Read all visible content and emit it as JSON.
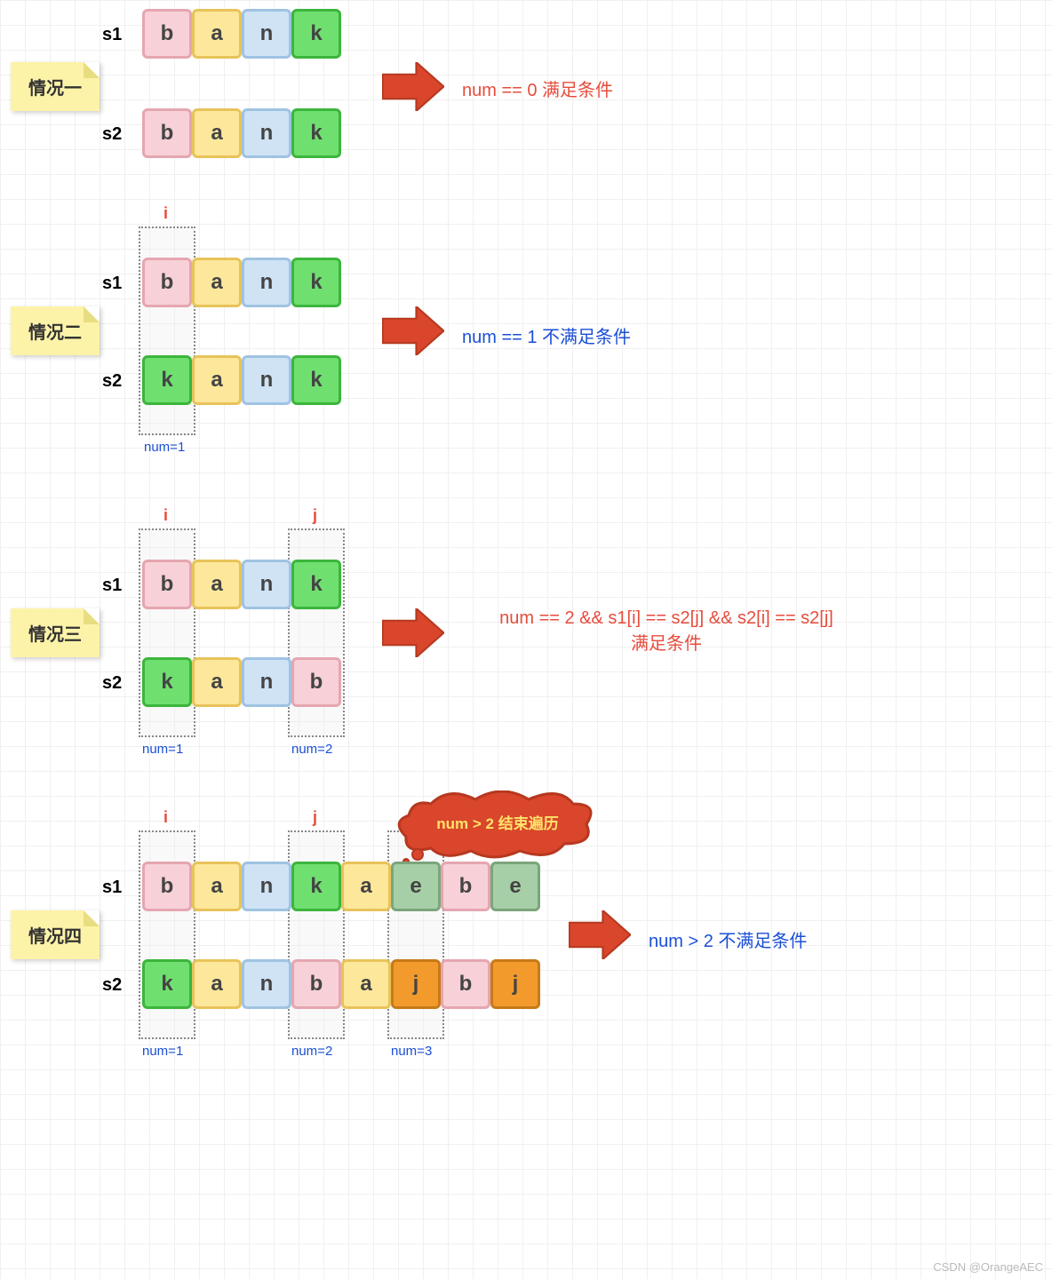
{
  "cases": [
    {
      "title": "情况一",
      "s1_label": "s1",
      "s2_label": "s2",
      "s1": [
        "b",
        "a",
        "n",
        "k"
      ],
      "s1_colors": [
        "pink",
        "yellow",
        "blue",
        "green"
      ],
      "s2": [
        "b",
        "a",
        "n",
        "k"
      ],
      "s2_colors": [
        "pink",
        "yellow",
        "blue",
        "green"
      ],
      "result": "num == 0 满足条件",
      "result_color": "red"
    },
    {
      "title": "情况二",
      "s1_label": "s1",
      "s2_label": "s2",
      "s1": [
        "b",
        "a",
        "n",
        "k"
      ],
      "s1_colors": [
        "pink",
        "yellow",
        "blue",
        "green"
      ],
      "s2": [
        "k",
        "a",
        "n",
        "k"
      ],
      "s2_colors": [
        "green",
        "yellow",
        "blue",
        "green"
      ],
      "markers": [
        {
          "idx": 0,
          "i_label": "i",
          "num_label": "num=1"
        }
      ],
      "result": "num == 1 不满足条件",
      "result_color": "bluec"
    },
    {
      "title": "情况三",
      "s1_label": "s1",
      "s2_label": "s2",
      "s1": [
        "b",
        "a",
        "n",
        "k"
      ],
      "s1_colors": [
        "pink",
        "yellow",
        "blue",
        "green"
      ],
      "s2": [
        "k",
        "a",
        "n",
        "b"
      ],
      "s2_colors": [
        "green",
        "yellow",
        "blue",
        "pink"
      ],
      "markers": [
        {
          "idx": 0,
          "i_label": "i",
          "num_label": "num=1"
        },
        {
          "idx": 3,
          "i_label": "j",
          "num_label": "num=2"
        }
      ],
      "result_lines": [
        "num == 2 && s1[i] == s2[j] && s2[i] == s2[j]",
        "满足条件"
      ],
      "result_color": "red"
    },
    {
      "title": "情况四",
      "s1_label": "s1",
      "s2_label": "s2",
      "s1": [
        "b",
        "a",
        "n",
        "k",
        "a",
        "e",
        "b",
        "e"
      ],
      "s1_colors": [
        "pink",
        "yellow",
        "blue",
        "green",
        "yellow",
        "sage",
        "pink",
        "sage"
      ],
      "s2": [
        "k",
        "a",
        "n",
        "b",
        "a",
        "j",
        "b",
        "j"
      ],
      "s2_colors": [
        "green",
        "yellow",
        "blue",
        "pink",
        "yellow",
        "orange",
        "pink",
        "orange"
      ],
      "markers": [
        {
          "idx": 0,
          "i_label": "i",
          "num_label": "num=1"
        },
        {
          "idx": 3,
          "i_label": "j",
          "num_label": "num=2"
        },
        {
          "idx": 5,
          "i_label": "",
          "num_label": "num=3"
        }
      ],
      "cloud": "num > 2 结束遍历",
      "result": "num > 2 不满足条件",
      "result_color": "bluec"
    }
  ],
  "watermark": "CSDN @OrangeAEC"
}
